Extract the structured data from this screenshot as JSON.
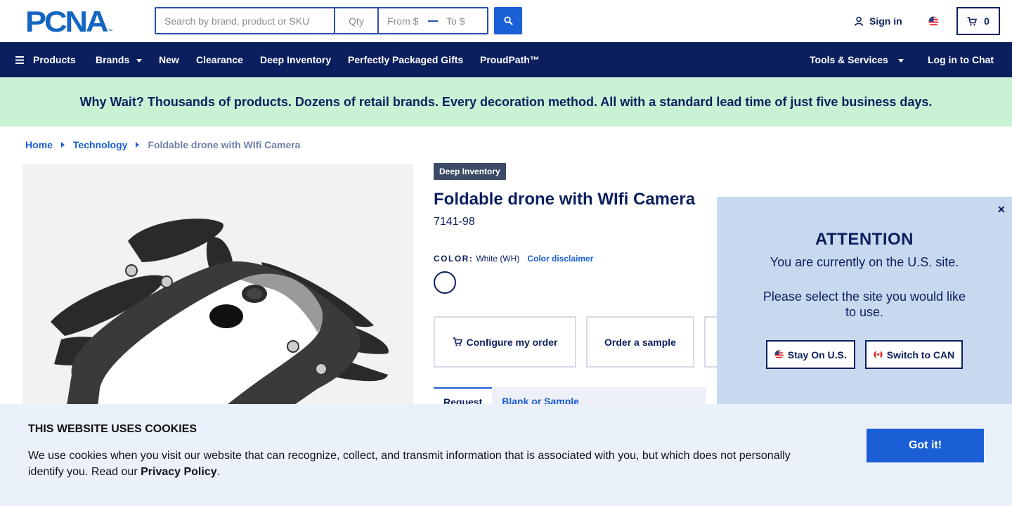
{
  "header": {
    "logo_text": "PCNA",
    "logo_tm": "™",
    "search_placeholder": "Search by brand, product or SKU",
    "qty_placeholder": "Qty",
    "from_placeholder": "From $",
    "to_placeholder": "To $",
    "sign_in": "Sign in",
    "cart_count": "0"
  },
  "nav": {
    "products": "Products",
    "brands": "Brands",
    "new": "New",
    "clearance": "Clearance",
    "deep_inventory": "Deep Inventory",
    "gifts": "Perfectly Packaged Gifts",
    "proudpath": "ProudPath™",
    "tools": "Tools & Services",
    "chat": "Log in to Chat"
  },
  "promo": {
    "text": "Why Wait? Thousands of products. Dozens of retail brands. Every decoration method. All with a standard lead time of just five business days."
  },
  "breadcrumb": {
    "home": "Home",
    "category": "Technology",
    "current": "Foldable drone with WIfi Camera"
  },
  "product": {
    "badge": "Deep Inventory",
    "title": "Foldable drone with WIfi Camera",
    "sku": "7141-98",
    "color_label": "COLOR:",
    "color_value": "White (WH)",
    "color_disclaimer": "Color disclaimer",
    "swatch_color": "#ffffff",
    "configure_button": "Configure my order",
    "sample_button": "Order a sample",
    "tab_active": "Request",
    "tab_other": "Blank or Sample"
  },
  "attention": {
    "close": "×",
    "heading": "ATTENTION",
    "line1": "You are currently on the U.S. site.",
    "line2": "Please select the site you would like to use.",
    "stay_button": "Stay On U.S.",
    "switch_button": "Switch to CAN"
  },
  "cookie": {
    "title": "THIS WEBSITE USES COOKIES",
    "text_before": "We use cookies when you visit our website that can recognize, collect, and transmit information that is associated with you, but which does not personally identify you. Read our ",
    "policy_link": "Privacy Policy",
    "text_after": ".",
    "button": "Got it!"
  },
  "colors": {
    "navy": "#0b1f5e",
    "blue": "#1b5fd6",
    "promo_bg": "#c9f2d5",
    "popup_bg": "#c8d9ef",
    "cookie_bg": "#eaf1fa"
  }
}
